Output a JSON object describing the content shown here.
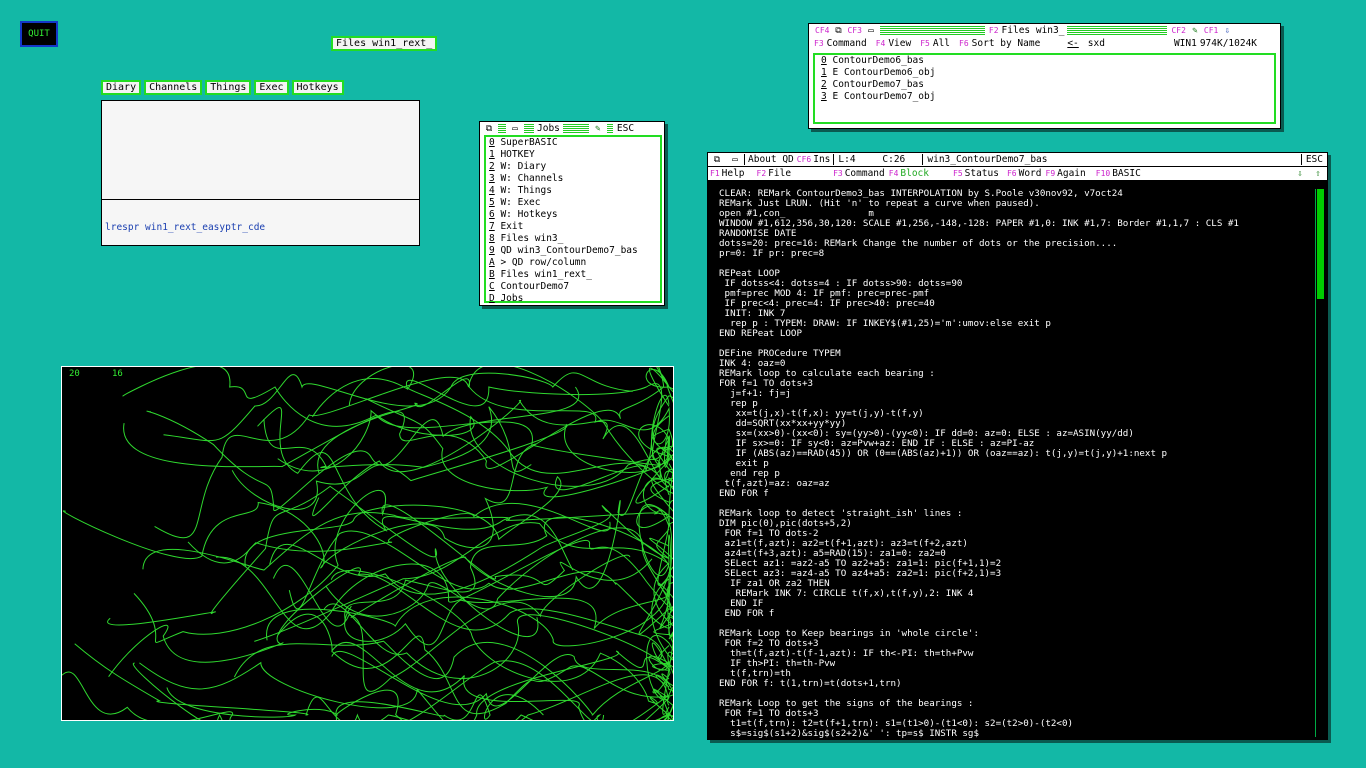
{
  "quit_label": "QUIT",
  "files_title_label": "Files win1_rext_",
  "menu": [
    "Diary",
    "Channels",
    "Things",
    "Exec",
    "Hotkeys"
  ],
  "diary": {
    "command": "lrespr win1_rext_easyptr_cde"
  },
  "jobs": {
    "title": "Jobs",
    "esc": "ESC",
    "items": [
      {
        "key": "0",
        "text": " SuperBASIC"
      },
      {
        "key": "1",
        "text": " HOTKEY"
      },
      {
        "key": "2",
        "text": " W: Diary"
      },
      {
        "key": "3",
        "text": " W: Channels"
      },
      {
        "key": "4",
        "text": " W: Things"
      },
      {
        "key": "5",
        "text": " W: Exec"
      },
      {
        "key": "6",
        "text": " W: Hotkeys"
      },
      {
        "key": "7",
        "text": " Exit"
      },
      {
        "key": "8",
        "text": " Files win3_"
      },
      {
        "key": "9",
        "text": " QD win3_ContourDemo7_bas"
      },
      {
        "key": "A",
        "text": " > QD row/column"
      },
      {
        "key": "B",
        "text": " Files win1_rext_"
      },
      {
        "key": "C",
        "text": " ContourDemo7"
      },
      {
        "key": "D",
        "text": " Jobs"
      }
    ]
  },
  "files": {
    "top": {
      "cf4": "CF4",
      "cf3": "CF3",
      "f2": "F2",
      "title": "Files win3_",
      "cf2": "CF2",
      "cf1": "CF1"
    },
    "cmd": {
      "f3": "F3",
      "command": "Command",
      "f4": "F4",
      "view": "View",
      "f5": "F5",
      "all": "All",
      "f6": "F6",
      "sort": "Sort by Name",
      "nav": "<-",
      "sxd": "sxd",
      "drive": "WIN1",
      "mem": "974K/1024K"
    },
    "items": [
      {
        "key": "0",
        "flag": " ",
        "name": "ContourDemo6_bas"
      },
      {
        "key": "1",
        "flag": "E",
        "name": "ContourDemo6_obj"
      },
      {
        "key": "2",
        "flag": " ",
        "name": "ContourDemo7_bas"
      },
      {
        "key": "3",
        "flag": "E",
        "name": "ContourDemo7_obj"
      }
    ]
  },
  "editor": {
    "top": {
      "about": "About QD",
      "cf6": "CF6",
      "ins": "Ins",
      "line": "L:4",
      "col": "C:26",
      "filename": "win3_ContourDemo7_bas",
      "esc": "ESC"
    },
    "fbar": [
      {
        "k": "F1",
        "t": "Help"
      },
      {
        "k": "F2",
        "t": "File"
      },
      {
        "k": "F3",
        "t": "Command"
      },
      {
        "k": "F4",
        "t": "Block"
      },
      {
        "k": "F5",
        "t": "Status"
      },
      {
        "k": "F6",
        "t": "Word"
      },
      {
        "k": "F9",
        "t": "Again"
      },
      {
        "k": "F10",
        "t": "BASIC"
      }
    ],
    "code": "CLEAR: REMark ContourDemo3_bas INTERPOLATION by S.Poole v30nov92, v7oct24\nREMark Just LRUN. (Hit 'n' to repeat a curve when paused).\nopen #1,con_               m\nWINDOW #1,612,356,30,120: SCALE #1,256,-148,-128: PAPER #1,0: INK #1,7: Border #1,1,7 : CLS #1\nRANDOMISE DATE\ndotss=20: prec=16: REMark Change the number of dots or the precision....\npr=0: IF pr: prec=8\n\nREPeat LOOP\n IF dotss<4: dotss=4 : IF dotss>90: dotss=90\n pmf=prec MOD 4: IF pmf: prec=prec-pmf\n IF prec<4: prec=4: IF prec>40: prec=40\n INIT: INK 7\n  rep p : TYPEM: DRAW: IF INKEY$(#1,25)='m':umov:else exit p\nEND REPeat LOOP\n\nDEFine PROCedure TYPEM\nINK 4: oaz=0\nREMark loop to calculate each bearing :\nFOR f=1 TO dots+3\n  j=f+1: fj=j\n  rep p\n   xx=t(j,x)-t(f,x): yy=t(j,y)-t(f,y)\n   dd=SQRT(xx*xx+yy*yy)\n   sx=(xx>0)-(xx<0): sy=(yy>0)-(yy<0): IF dd=0: az=0: ELSE : az=ASIN(yy/dd)\n   IF sx>=0: IF sy<0: az=Pvw+az: END IF : ELSE : az=PI-az\n   IF (ABS(az)==RAD(45)) OR (0==(ABS(az)+1)) OR (oaz==az): t(j,y)=t(j,y)+1:next p\n   exit p\n  end rep p\n t(f,azt)=az: oaz=az\nEND FOR f\n\nREMark loop to detect 'straight_ish' lines :\nDIM pic(0),pic(dots+5,2)\n FOR f=1 TO dots-2\n az1=t(f,azt): az2=t(f+1,azt): az3=t(f+2,azt)\n az4=t(f+3,azt): a5=RAD(15): za1=0: za2=0\n SELect az1: =az2-a5 TO az2+a5: za1=1: pic(f+1,1)=2\n SELect az3: =az4-a5 TO az4+a5: za2=1: pic(f+2,1)=3\n  IF za1 OR za2 THEN\n   REMark INK 7: CIRCLE t(f,x),t(f,y),2: INK 4\n  END IF\n END FOR f\n\nREMark Loop to Keep bearings in 'whole circle':\n FOR f=2 TO dots+3\n  th=t(f,azt)-t(f-1,azt): IF th<-PI: th=th+Pvw\n  IF th>PI: th=th-Pvw\n  t(f,trn)=th\nEND FOR f: t(1,trn)=t(dots+1,trn)\n\nREMark Loop to get the signs of the bearings :\n FOR f=1 TO dots+3\n  t1=t(f,trn): t2=t(f+1,trn): s1=(t1>0)-(t1<0): s2=(t2>0)-(t2<0)\n  s$=sig$(s1+2)&sig$(s2+2)&' ': tp=s$ INSTR sg$"
  },
  "plot": {
    "n1": "20",
    "n2": "16",
    "curve_color": "#2fd82f",
    "background": "#000000"
  },
  "colors": {
    "desktop": "#13b8a6",
    "accent_green": "#22dd22",
    "fkey_magenta": "#cc22cc"
  }
}
